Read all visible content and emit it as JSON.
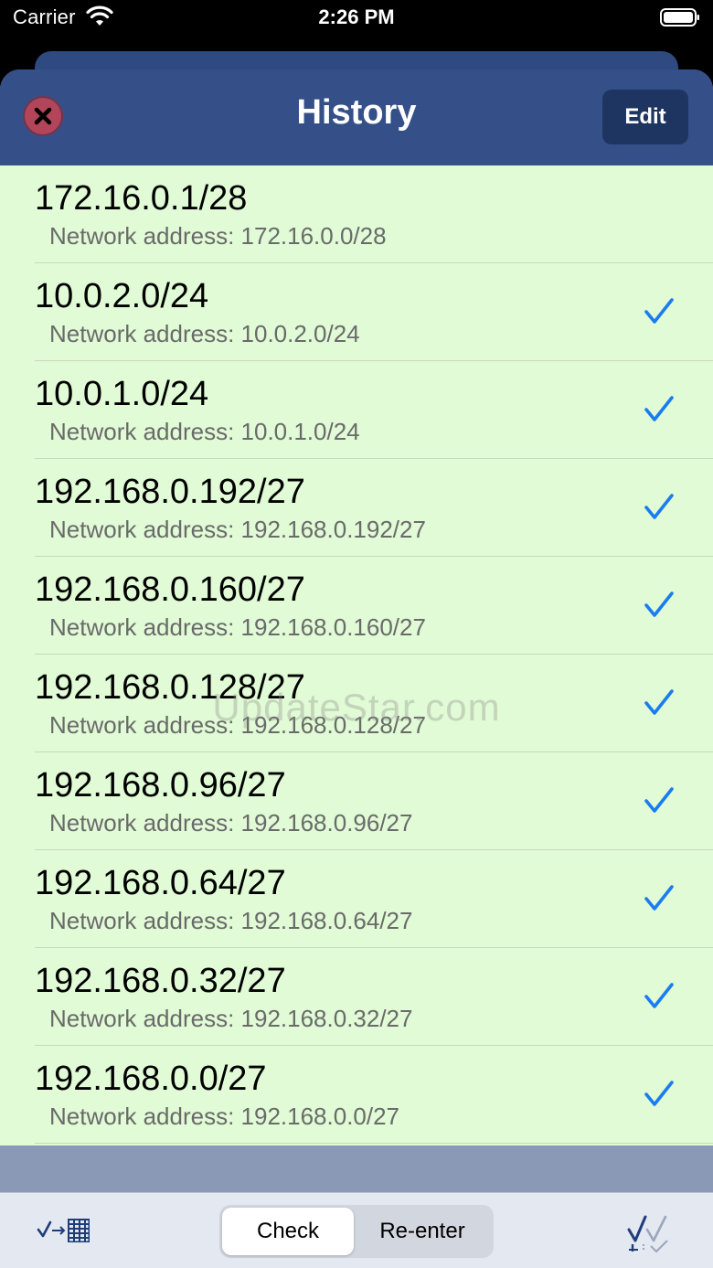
{
  "status_bar": {
    "carrier": "Carrier",
    "time": "2:26 PM"
  },
  "nav": {
    "title": "History",
    "edit_label": "Edit"
  },
  "history": [
    {
      "title": "172.16.0.1/28",
      "subtitle": "Network address: 172.16.0.0/28",
      "checked": false
    },
    {
      "title": "10.0.2.0/24",
      "subtitle": "Network address: 10.0.2.0/24",
      "checked": true
    },
    {
      "title": "10.0.1.0/24",
      "subtitle": "Network address: 10.0.1.0/24",
      "checked": true
    },
    {
      "title": "192.168.0.192/27",
      "subtitle": "Network address: 192.168.0.192/27",
      "checked": true
    },
    {
      "title": "192.168.0.160/27",
      "subtitle": "Network address: 192.168.0.160/27",
      "checked": true
    },
    {
      "title": "192.168.0.128/27",
      "subtitle": "Network address: 192.168.0.128/27",
      "checked": true
    },
    {
      "title": "192.168.0.96/27",
      "subtitle": "Network address: 192.168.0.96/27",
      "checked": true
    },
    {
      "title": "192.168.0.64/27",
      "subtitle": "Network address: 192.168.0.64/27",
      "checked": true
    },
    {
      "title": "192.168.0.32/27",
      "subtitle": "Network address: 192.168.0.32/27",
      "checked": true
    },
    {
      "title": "192.168.0.0/27",
      "subtitle": "Network address: 192.168.0.0/27",
      "checked": true
    }
  ],
  "watermark": "UpdateStar.com",
  "toolbar": {
    "left_icon": "check-to-calculator-icon",
    "check_label": "Check",
    "reenter_label": "Re-enter",
    "right_icon": "multi-check-icon"
  },
  "colors": {
    "nav_background": "#355089",
    "list_background": "#e0fbd5",
    "accent": "#1a7cf2",
    "close_button": "#b2455a"
  }
}
